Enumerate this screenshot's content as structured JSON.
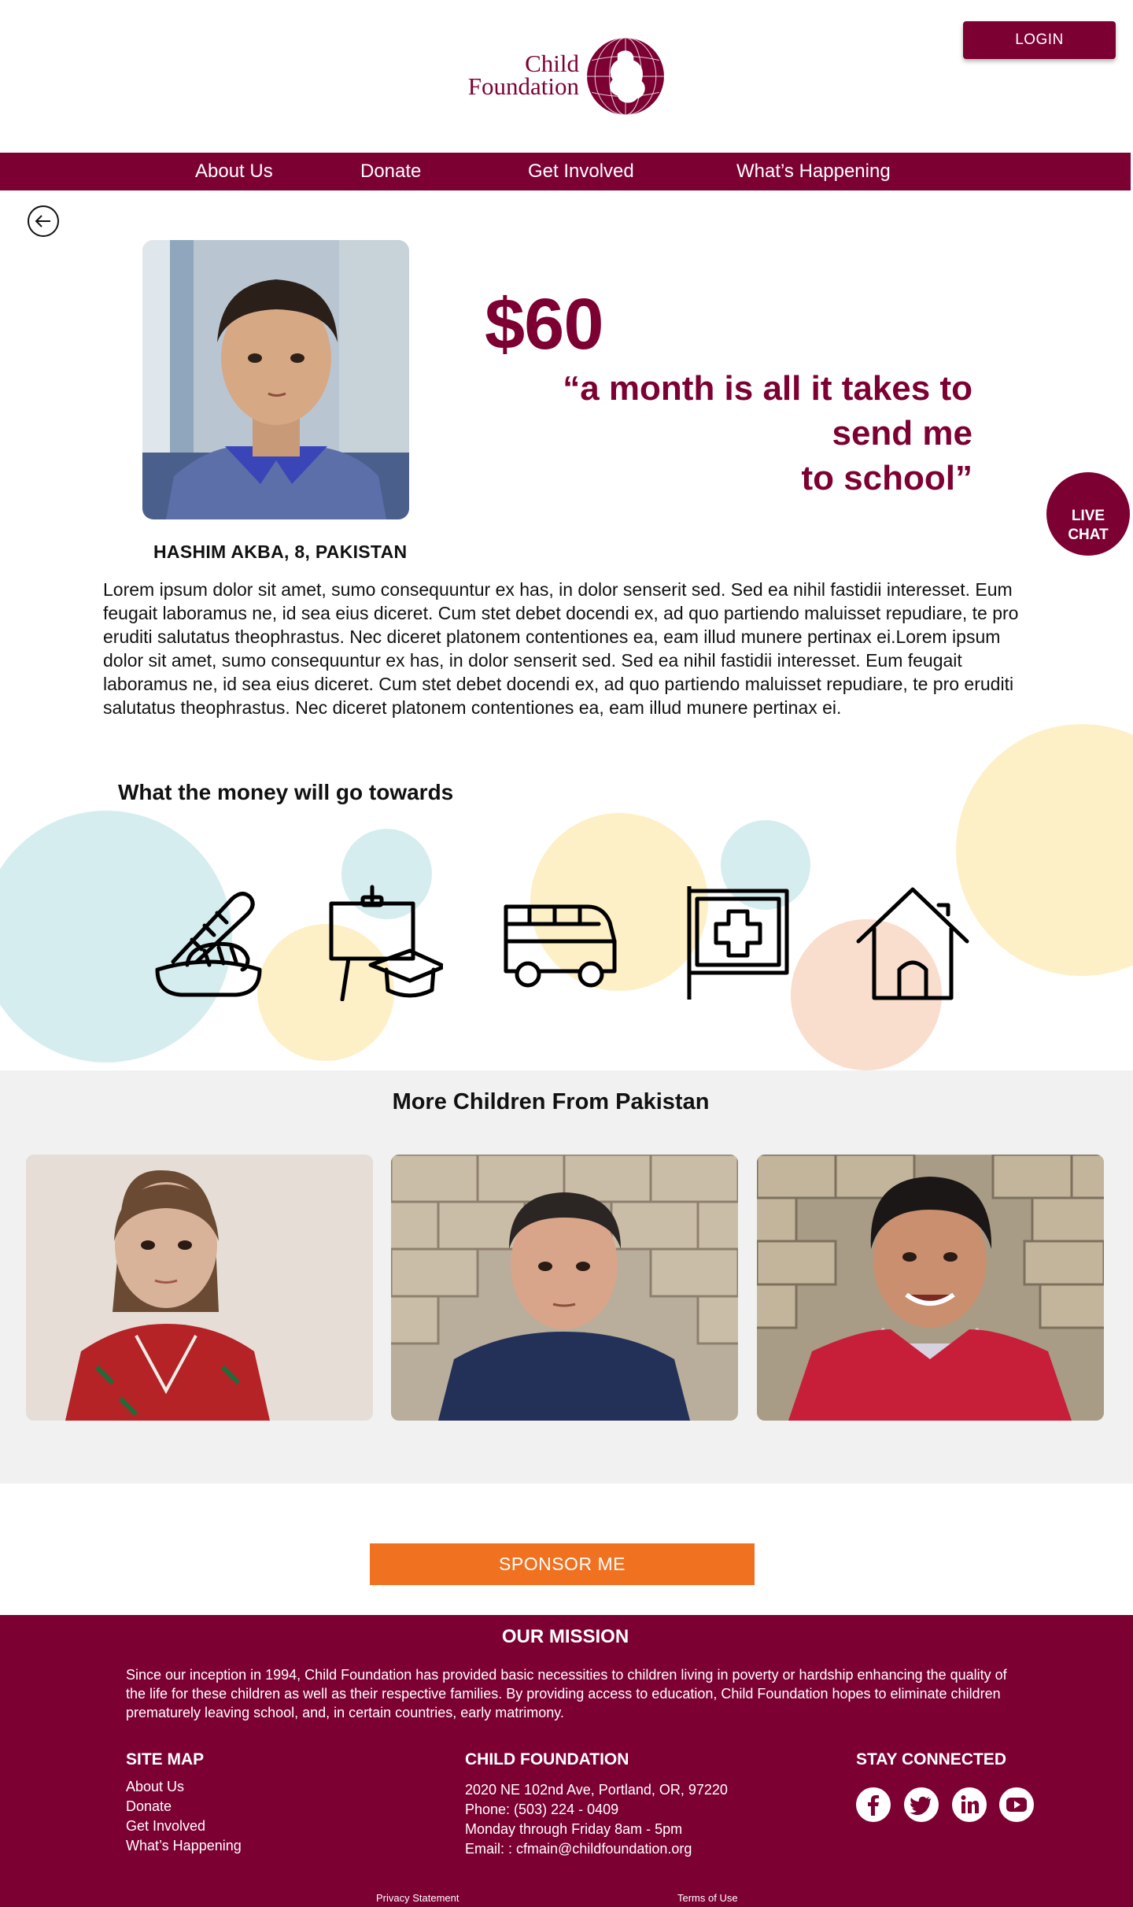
{
  "brand": {
    "line1": "Child",
    "line2": "Foundation",
    "color": "#7d0033"
  },
  "header": {
    "login_label": "LOGIN"
  },
  "nav": {
    "items": [
      {
        "label": "About Us"
      },
      {
        "label": "Donate"
      },
      {
        "label": "Get Involved"
      },
      {
        "label": "What’s Happening"
      }
    ]
  },
  "hero": {
    "back_icon": "arrow-left-circle-icon",
    "caption": "HASHIM AKBA, 8, PAKISTAN",
    "price": "$60",
    "quote_line1": "“a month is all it takes to send me",
    "quote_line2": "to school”"
  },
  "live_chat": {
    "line1": "LIVE",
    "line2": "CHAT"
  },
  "story": {
    "text": "Lorem ipsum dolor sit amet, sumo consequuntur ex has, in dolor senserit sed. Sed ea nihil fastidii interesset. Eum feugait laboramus ne, id sea eius diceret. Cum stet debet docendi ex, ad quo partiendo maluisset repudiare, te pro eruditi salutatus theophrastus. Nec diceret platonem contentiones ea, eam illud munere pertinax ei.Lorem ipsum dolor sit amet, sumo consequuntur ex has, in dolor senserit sed. Sed ea nihil fastidii interesset. Eum feugait laboramus ne, id sea eius diceret. Cum stet debet docendi ex, ad quo partiendo maluisset repudiare, te pro eruditi salutatus theophrastus. Nec diceret platonem contentiones ea, eam illud munere pertinax ei."
  },
  "towards": {
    "title": "What the money will go towards",
    "icons": [
      "food-icon",
      "education-icon",
      "bus-icon",
      "medical-icon",
      "home-icon"
    ],
    "bubble_colors": {
      "blue": "#d6edf0",
      "yellow": "#fdf0c6",
      "peach": "#f9ddcd"
    }
  },
  "more": {
    "title": "More Children From Pakistan",
    "cards": [
      {
        "name": "child-card-girl"
      },
      {
        "name": "child-card-boy"
      },
      {
        "name": "child-card-smiling-boy"
      }
    ]
  },
  "sponsor": {
    "label": "SPONSOR ME",
    "color": "#f07221"
  },
  "footer": {
    "mission_title": "OUR MISSION",
    "mission_text": "Since our inception in 1994, Child Foundation has provided basic necessities to children living in poverty or hardship enhancing the quality of the life for these children as well as their respective families. By providing access to education, Child Foundation hopes to eliminate children prematurely leaving school, and, in certain countries, early matrimony.",
    "sitemap_title": "SITE MAP",
    "sitemap": [
      "About Us",
      "Donate",
      "Get Involved",
      "What’s Happening"
    ],
    "org_title": "CHILD FOUNDATION",
    "address": "2020 NE 102nd Ave, Portland, OR, 97220",
    "phone": "Phone: (503) 224 - 0409",
    "hours": "Monday through Friday 8am - 5pm",
    "email": "Email: : cfmain@childfoundation.org",
    "connect_title": "STAY CONNECTED",
    "social": [
      "facebook-icon",
      "twitter-icon",
      "linkedin-icon",
      "youtube-icon"
    ],
    "privacy": "Privacy Statement",
    "terms": "Terms of Use"
  }
}
